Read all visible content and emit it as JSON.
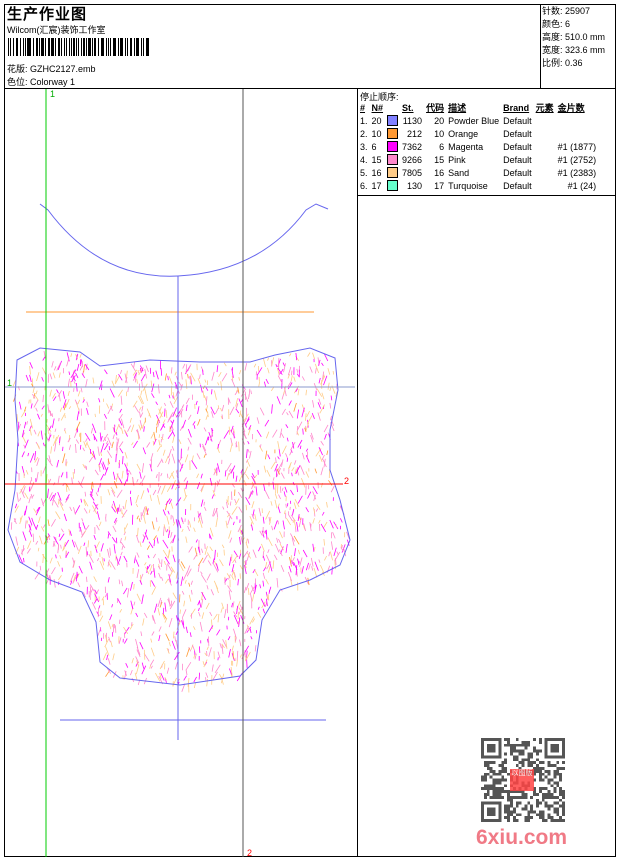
{
  "header": {
    "title": "生产作业图",
    "company": "Wilcom(汇宸)装饰工作室",
    "design_label": "花版:",
    "design_value": "GZHC2127.emb",
    "colorway_label": "色位:",
    "colorway_value": "Colorway 1"
  },
  "info": {
    "stitches_label": "针数:",
    "stitches": "25907",
    "colors_label": "颜色:",
    "colors": "6",
    "height_label": "高度:",
    "height": "510.0 mm",
    "width_label": "宽度:",
    "width": "323.6 mm",
    "scale_label": "比例:",
    "scale": "0.36"
  },
  "stop_sequence": {
    "title": "停止顺序:",
    "columns": [
      "#",
      "N#",
      "St.",
      "代码",
      "描述",
      "Brand",
      "元素",
      "金片数"
    ],
    "rows": [
      {
        "idx": "1.",
        "n": "20",
        "color": "#8080ff",
        "st": "1130",
        "code": "20",
        "desc": "Powder Blue",
        "brand": "Default",
        "elem": "",
        "sequins": ""
      },
      {
        "idx": "2.",
        "n": "10",
        "color": "#ff9933",
        "st": "212",
        "code": "10",
        "desc": "Orange",
        "brand": "Default",
        "elem": "",
        "sequins": ""
      },
      {
        "idx": "3.",
        "n": "6",
        "color": "#ff00ff",
        "st": "7362",
        "code": "6",
        "desc": "Magenta",
        "brand": "Default",
        "elem": "",
        "sequins": "#1 (1877)"
      },
      {
        "idx": "4.",
        "n": "15",
        "color": "#ff88cc",
        "st": "9266",
        "code": "15",
        "desc": "Pink",
        "brand": "Default",
        "elem": "",
        "sequins": "#1 (2752)"
      },
      {
        "idx": "5.",
        "n": "16",
        "color": "#ffcc88",
        "st": "7805",
        "code": "16",
        "desc": "Sand",
        "brand": "Default",
        "elem": "",
        "sequins": "#1 (2383)"
      },
      {
        "idx": "6.",
        "n": "17",
        "color": "#66ffcc",
        "st": "130",
        "code": "17",
        "desc": "Turquoise",
        "brand": "Default",
        "elem": "",
        "sequins": "#1 (24)"
      }
    ]
  },
  "guides": {
    "label_1": "1",
    "label_2": "2"
  },
  "watermark": {
    "site": "6xiu.com",
    "stamp": "以图版"
  }
}
